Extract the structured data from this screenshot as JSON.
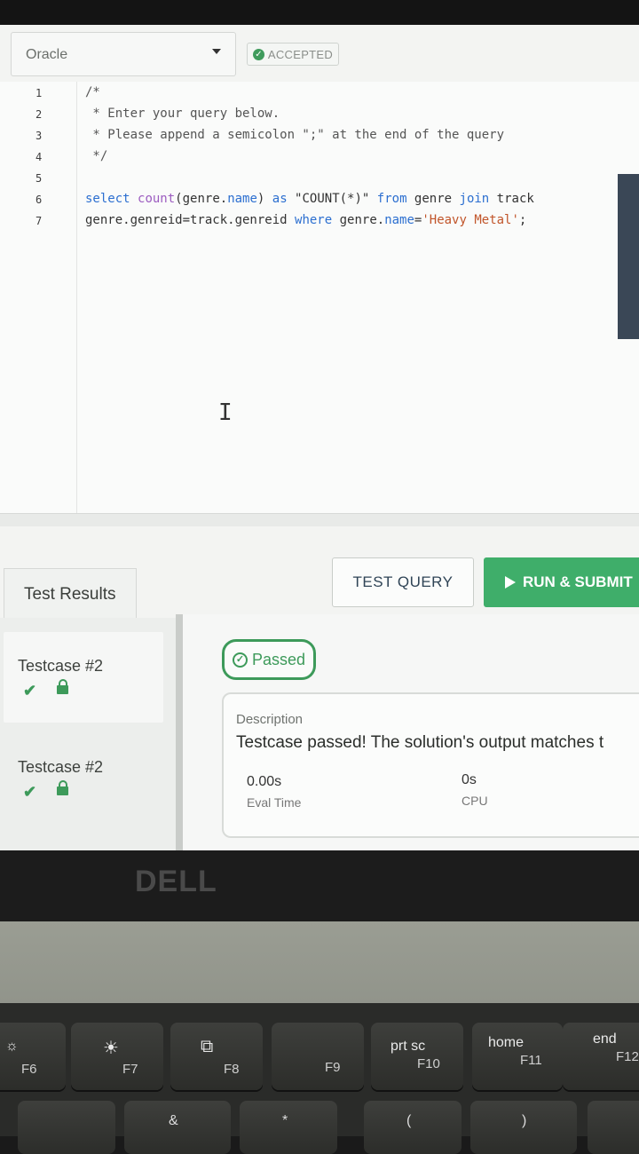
{
  "editor_header": {
    "language": "Oracle",
    "status_badge": "ACCEPTED"
  },
  "editor": {
    "line_numbers": [
      "1",
      "2",
      "3",
      "4",
      "5",
      "6",
      "7"
    ],
    "lines": [
      "/*",
      " * Enter your query below.",
      " * Please append a semicolon \";\" at the end of the query",
      " */",
      "",
      "select count(genre.name) as \"COUNT(*)\" from genre join track",
      "genre.genreid=track.genreid where genre.name='Heavy Metal';"
    ]
  },
  "results": {
    "tab_label": "Test Results",
    "test_query_label": "TEST QUERY",
    "run_submit_label": "RUN & SUBMIT",
    "testcases": [
      {
        "name": "Testcase #2"
      },
      {
        "name": "Testcase #2"
      }
    ],
    "status": "Passed",
    "description_label": "Description",
    "description_text": "Testcase passed! The solution's output matches t",
    "eval_time_value": "0.00s",
    "eval_time_label": "Eval Time",
    "cpu_value": "0s",
    "cpu_label": "CPU"
  },
  "laptop": {
    "brand": "DELL",
    "keys": [
      {
        "icon": "brightness-down-icon",
        "label": "F6"
      },
      {
        "icon": "brightness-up-icon",
        "label": "F7"
      },
      {
        "icon": "display-switch-icon",
        "label": "F8"
      },
      {
        "icon": "",
        "label": "F9"
      },
      {
        "top": "prt sc",
        "label": "F10"
      },
      {
        "top": "home",
        "label": "F11"
      },
      {
        "top": "end",
        "label": "F12"
      }
    ]
  }
}
